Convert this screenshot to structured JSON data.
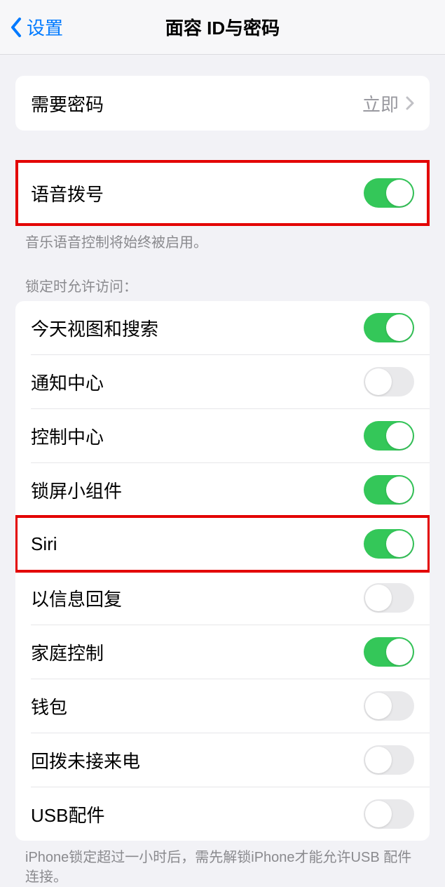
{
  "header": {
    "back_label": "设置",
    "title": "面容 ID与密码"
  },
  "require_passcode": {
    "label": "需要密码",
    "value": "立即"
  },
  "voice_dial": {
    "label": "语音拨号",
    "on": true,
    "footer": "音乐语音控制将始终被启用。"
  },
  "lock_section": {
    "header": "锁定时允许访问：",
    "items": [
      {
        "label": "今天视图和搜索",
        "on": true
      },
      {
        "label": "通知中心",
        "on": false
      },
      {
        "label": "控制中心",
        "on": true
      },
      {
        "label": "锁屏小组件",
        "on": true
      },
      {
        "label": "Siri",
        "on": true
      },
      {
        "label": "以信息回复",
        "on": false
      },
      {
        "label": "家庭控制",
        "on": true
      },
      {
        "label": "钱包",
        "on": false
      },
      {
        "label": "回拨未接来电",
        "on": false
      },
      {
        "label": "USB配件",
        "on": false
      }
    ],
    "footer": "iPhone锁定超过一小时后，需先解锁iPhone才能允许USB 配件连接。"
  },
  "highlighted_indices": [
    4
  ]
}
